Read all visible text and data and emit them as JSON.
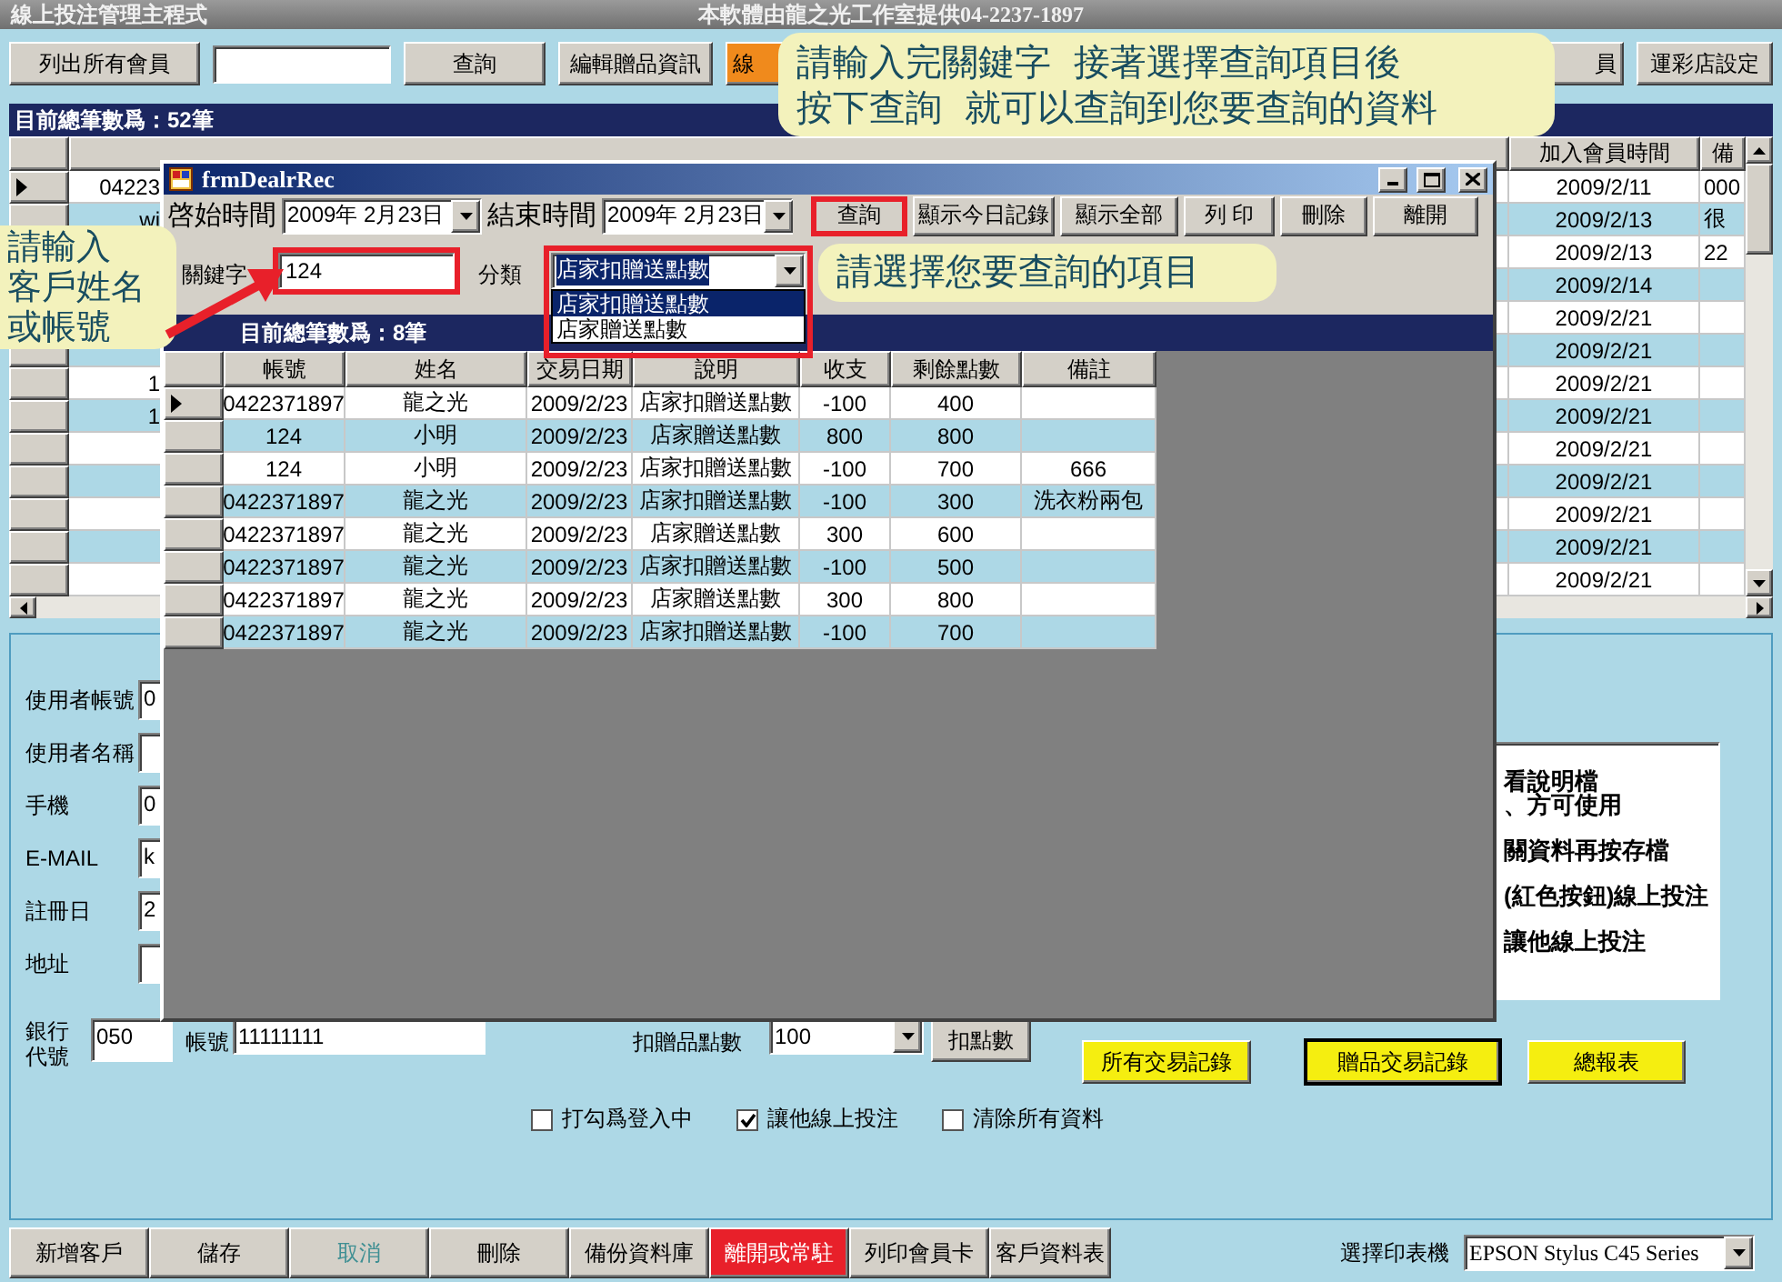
{
  "window": {
    "title": "線上投注管理主程式",
    "credit": "本軟體由龍之光工作室提供04-2237-1897"
  },
  "toolbar": [
    {
      "kind": "button",
      "label": "列出所有會員"
    },
    {
      "kind": "field"
    },
    {
      "kind": "button",
      "label": "查詢"
    },
    {
      "kind": "button",
      "label": "編輯贈品資訊"
    },
    {
      "kind": "accent",
      "label": "線"
    },
    {
      "kind": "tail",
      "label": "員"
    },
    {
      "kind": "button",
      "label": "運彩店設定"
    }
  ],
  "member_count": "目前總筆數爲：52筆",
  "member_grid": {
    "columns": [
      "加入會員時間",
      "備"
    ],
    "rows": [
      {
        "current": true,
        "column_1": "04223",
        "joined": "2009/2/11",
        "note": "000"
      },
      {
        "current": false,
        "column_1": "wi",
        "joined": "2009/2/13",
        "note": "很"
      },
      {
        "joined": "2009/2/13",
        "note": "22"
      },
      {
        "joined": "2009/2/14"
      },
      {
        "joined": "2009/2/21"
      },
      {
        "current": false,
        "joined": "2009/2/21"
      },
      {
        "current": false,
        "column_1": "1",
        "joined": "2009/2/21"
      },
      {
        "current": false,
        "column_1": "1",
        "joined": "2009/2/21"
      },
      {
        "current": false,
        "joined": "2009/2/21"
      },
      {
        "current": false,
        "joined": "2009/2/21"
      },
      {
        "current": false,
        "joined": "2009/2/21"
      },
      {
        "current": false,
        "joined": "2009/2/21"
      },
      {
        "current": false,
        "joined": "2009/2/21"
      }
    ]
  },
  "dialog": {
    "title": "frmDealrRec",
    "start": {
      "label": "啓始時間",
      "value": "2009年 2月23日"
    },
    "end": {
      "label": "結束時間",
      "value": "2009年 2月23日"
    },
    "buttons": [
      {
        "label": "查詢",
        "highlighted": true
      },
      {
        "label": "顯示今日記錄",
        "highlighted": false
      },
      {
        "label": "顯示全部",
        "highlighted": false
      },
      {
        "label": "列 印",
        "highlighted": false
      },
      {
        "label": "刪除",
        "highlighted": false
      },
      {
        "label": "離開",
        "highlighted": false
      }
    ],
    "keyword": {
      "label": "關鍵字",
      "value": "124",
      "highlighted": true
    },
    "category": {
      "label": "分類",
      "value": "店家扣贈送點數",
      "expanded": true,
      "highlighted": true,
      "options": [
        {
          "label": "店家扣贈送點數",
          "selected": true
        },
        {
          "label": "店家贈送點數",
          "selected": false
        }
      ]
    },
    "count": "目前總筆數爲：8筆",
    "columns": [
      "帳號",
      "姓名",
      "交易日期",
      "說明",
      "收支",
      "剩餘點數",
      "備註"
    ],
    "rows": [
      {
        "current": true,
        "cells": [
          "0422371897",
          "龍之光",
          "2009/2/23",
          "店家扣贈送點數",
          "-100",
          "400",
          ""
        ]
      },
      {
        "current": false,
        "cells": [
          "124",
          "小明",
          "2009/2/23",
          "店家贈送點數",
          "800",
          "800",
          ""
        ]
      },
      {
        "current": false,
        "cells": [
          "124",
          "小明",
          "2009/2/23",
          "店家扣贈送點數",
          "-100",
          "700",
          "666"
        ]
      },
      {
        "current": false,
        "cells": [
          "0422371897",
          "龍之光",
          "2009/2/23",
          "店家扣贈送點數",
          "-100",
          "300",
          "洗衣粉兩包"
        ]
      },
      {
        "current": false,
        "cells": [
          "0422371897",
          "龍之光",
          "2009/2/23",
          "店家贈送點數",
          "300",
          "600",
          ""
        ]
      },
      {
        "current": false,
        "cells": [
          "0422371897",
          "龍之光",
          "2009/2/23",
          "店家扣贈送點數",
          "-100",
          "500",
          ""
        ]
      },
      {
        "current": false,
        "cells": [
          "0422371897",
          "龍之光",
          "2009/2/23",
          "店家贈送點數",
          "300",
          "800",
          ""
        ]
      },
      {
        "current": false,
        "cells": [
          "0422371897",
          "龍之光",
          "2009/2/23",
          "店家扣贈送點數",
          "-100",
          "700",
          ""
        ]
      }
    ]
  },
  "profile": {
    "fields": [
      {
        "label": "使用者帳號",
        "value": "0"
      },
      {
        "label": "使用者名稱"
      },
      {
        "label": "手機",
        "value": "0"
      },
      {
        "label": "E-MAIL",
        "value": "k"
      },
      {
        "label": "註冊日",
        "value": "2"
      },
      {
        "label": "地址"
      }
    ],
    "notes": [
      "看說明檔",
      "、方可使用",
      "關資料再按存檔",
      "(紅色按鈕)線上投注",
      "讓他線上投注"
    ],
    "bank_code": {
      "label": "銀行代號",
      "value": "050"
    },
    "account": {
      "label": "帳號",
      "value": "11111111"
    },
    "deduct": {
      "label": "扣贈品點數",
      "value": "100",
      "button": "扣點數"
    },
    "report_buttons": [
      {
        "label": "所有交易記錄",
        "focused": false
      },
      {
        "label": "贈品交易記錄",
        "focused": true
      },
      {
        "label": "總報表",
        "focused": false
      }
    ],
    "options": [
      {
        "label": "打勾爲登入中",
        "checked": false
      },
      {
        "label": "讓他線上投注",
        "checked": true
      },
      {
        "label": "清除所有資料",
        "checked": false
      }
    ]
  },
  "bottom_bar": [
    {
      "label": "新增客戶",
      "kind": "normal",
      "disabled": false
    },
    {
      "label": "儲存",
      "kind": "normal",
      "disabled": false
    },
    {
      "label": "取消",
      "kind": "normal",
      "disabled": true
    },
    {
      "label": "刪除",
      "kind": "normal",
      "disabled": false
    },
    {
      "label": "備份資料庫",
      "kind": "normal",
      "disabled": false
    },
    {
      "label": "離開或常駐",
      "kind": "alert",
      "disabled": false
    },
    {
      "label": "列印會員卡",
      "kind": "normal",
      "disabled": false
    },
    {
      "label": "客戶資料表",
      "kind": "normal",
      "disabled": false
    }
  ],
  "printer": {
    "label": "選擇印表機",
    "value": "EPSON Stylus C45 Series"
  },
  "callouts": [
    {
      "kind": "top",
      "lines": [
        "請輸入完關鍵字  接著選擇查詢項目後",
        "按下查詢  就可以查詢到您要查詢的資料"
      ]
    },
    {
      "kind": "left",
      "lines": [
        "請輸入",
        "客戶姓名",
        "或帳號"
      ]
    },
    {
      "kind": "middle",
      "lines": [
        "請選擇您要查詢的項目"
      ]
    }
  ]
}
